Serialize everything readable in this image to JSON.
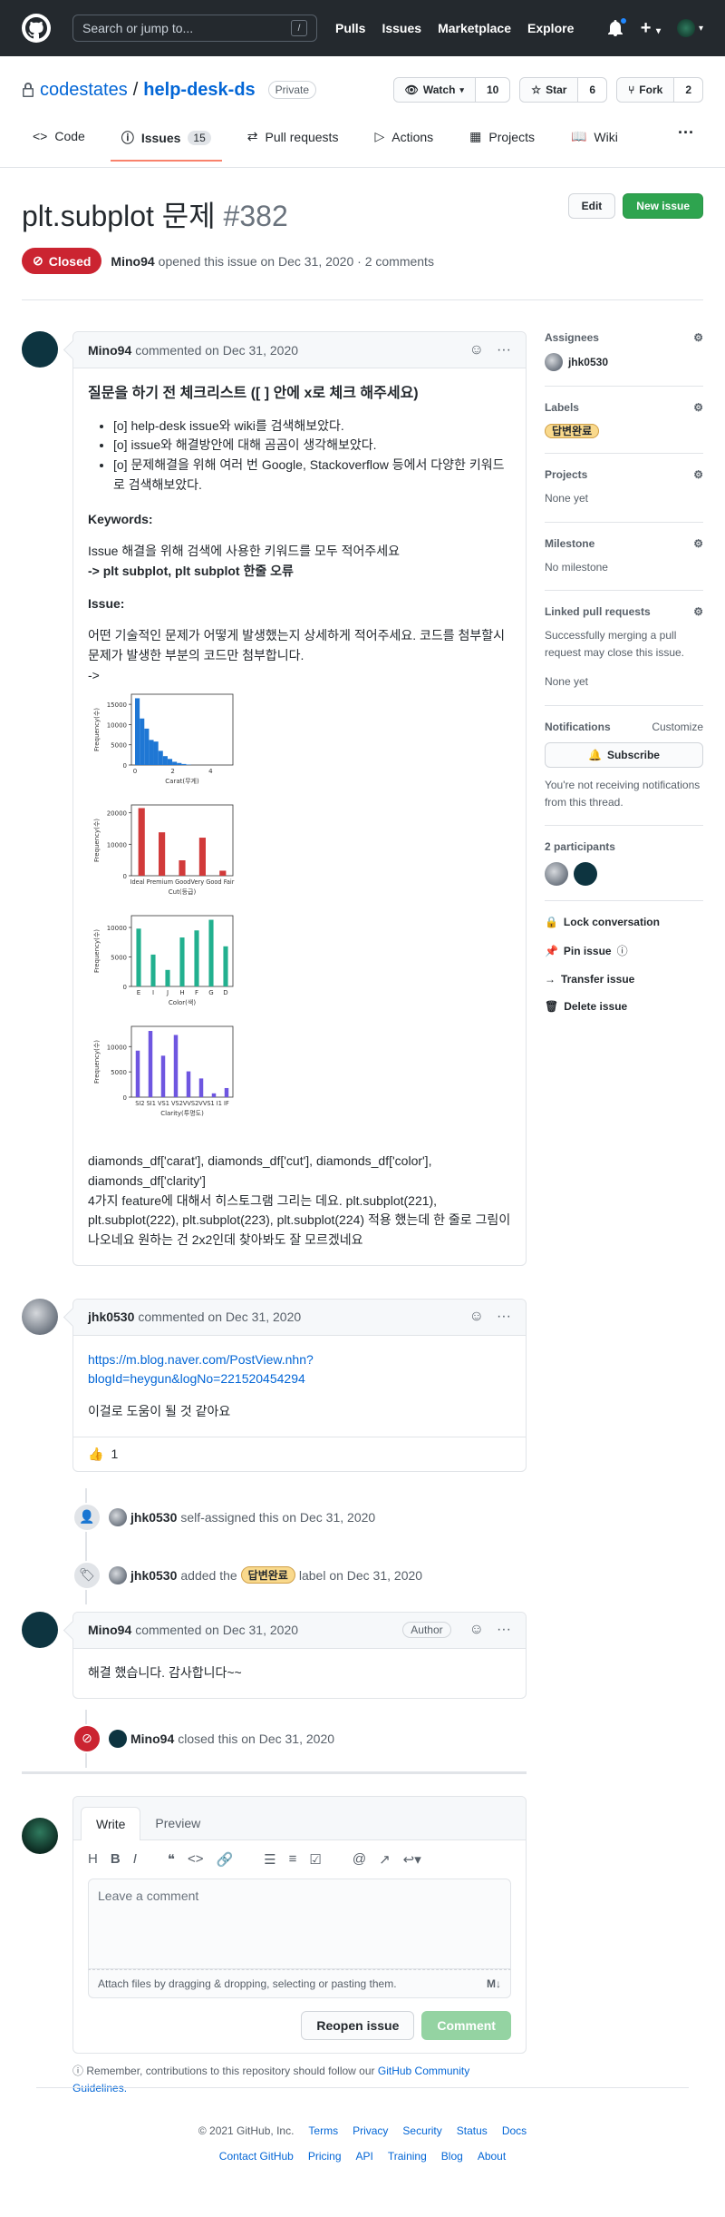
{
  "header": {
    "search_placeholder": "Search or jump to...",
    "slash_key": "/",
    "nav": [
      "Pulls",
      "Issues",
      "Marketplace",
      "Explore"
    ]
  },
  "repo": {
    "owner": "codestates",
    "separator": "/",
    "name": "help-desk-ds",
    "visibility": "Private",
    "watch_label": "Watch",
    "watch_count": "10",
    "star_label": "Star",
    "star_count": "6",
    "fork_label": "Fork",
    "fork_count": "2"
  },
  "tabs": {
    "code": "Code",
    "issues": "Issues",
    "issues_count": "15",
    "pulls": "Pull requests",
    "actions": "Actions",
    "projects": "Projects",
    "wiki": "Wiki",
    "more": "···"
  },
  "issue": {
    "title": "plt.subplot 문제",
    "number": "#382",
    "edit": "Edit",
    "new_issue": "New issue",
    "state": "Closed",
    "author": "Mino94",
    "meta": "opened this issue on Dec 31, 2020 · 2 comments"
  },
  "comment1": {
    "author": "Mino94",
    "meta": "commented on Dec 31, 2020",
    "heading": "질문을 하기 전 체크리스트 ([ ] 안에 x로 체크 해주세요)",
    "checklist": [
      "[o] help-desk issue와 wiki를 검색해보았다.",
      "[o] issue와 해결방안에 대해 곰곰이 생각해보았다.",
      "[o] 문제해결을 위해 여러 번 Google, Stackoverflow 등에서 다양한 키워드로 검색해보았다."
    ],
    "keywords_title": "Keywords:",
    "keywords_text": "Issue 해결을 위해 검색에 사용한 키워드를 모두 적어주세요",
    "keywords_value": "-> plt subplot, plt subplot 한줄 오류",
    "issue_title": "Issue:",
    "issue_text": "어떤 기술적인 문제가 어떻게 발생했는지 상세하게 적어주세요. 코드를 첨부할시 문제가 발생한 부분의 코드만 첨부합니다.",
    "arrow": "->",
    "footer_line1": "diamonds_df['carat'], diamonds_df['cut'], diamonds_df['color'], diamonds_df['clarity']",
    "footer_line2": "4가지 feature에 대해서 히스토그램 그리는 데요. plt.subplot(221), plt.subplot(222), plt.subplot(223), plt.subplot(224) 적용 했는데 한 줄로 그림이 나오네요 원하는 건 2x2인데 찾아봐도 잘 모르겠네요"
  },
  "chart_data": [
    {
      "type": "bar",
      "title": "",
      "xlabel": "Carat(무게)",
      "ylabel": "Frequency(수)",
      "x": [
        0.2,
        0.4,
        0.6,
        0.8,
        1.0,
        1.2,
        1.4,
        1.6,
        1.8,
        2.0,
        2.2,
        2.4
      ],
      "values": [
        16500,
        11500,
        9000,
        6200,
        5800,
        3500,
        2200,
        1500,
        800,
        500,
        250,
        100
      ],
      "xticks": [
        "0",
        "2",
        "4"
      ],
      "yticks": [
        "0",
        "5000",
        "10000",
        "15000"
      ],
      "ylim": [
        0,
        17500
      ],
      "color": "#1f77d4"
    },
    {
      "type": "bar",
      "title": "",
      "xlabel": "Cut(등급)",
      "ylabel": "Frequency(수)",
      "categories": [
        "Ideal",
        "Premium",
        "Good",
        "Very Good",
        "Fair"
      ],
      "xtick_text": "Ideal  Premium  GoodVery Good  Fair",
      "values": [
        21500,
        13800,
        4900,
        12100,
        1600
      ],
      "yticks": [
        "0",
        "10000",
        "20000"
      ],
      "ylim": [
        0,
        22500
      ],
      "color": "#d13a3a"
    },
    {
      "type": "bar",
      "title": "",
      "xlabel": "Color(색)",
      "ylabel": "Frequency(수)",
      "categories": [
        "E",
        "I",
        "J",
        "H",
        "F",
        "G",
        "D"
      ],
      "values": [
        9800,
        5400,
        2800,
        8300,
        9500,
        11300,
        6800
      ],
      "yticks": [
        "0",
        "5000",
        "10000"
      ],
      "ylim": [
        0,
        12000
      ],
      "color": "#22b08f"
    },
    {
      "type": "bar",
      "title": "",
      "xlabel": "Clarity(투명도)",
      "ylabel": "Frequency(수)",
      "categories": [
        "SI2",
        "SI1",
        "VS1",
        "VS2",
        "VVS2",
        "VVS1",
        "I1",
        "IF"
      ],
      "xtick_text": "SI2  SI1  VS1 VS2VVS2VVS1  I1   IF",
      "values": [
        9200,
        13100,
        8200,
        12300,
        5100,
        3700,
        750,
        1800
      ],
      "yticks": [
        "0",
        "5000",
        "10000"
      ],
      "ylim": [
        0,
        14000
      ],
      "color": "#6e56e0"
    }
  ],
  "comment2": {
    "author": "jhk0530",
    "meta": "commented on Dec 31, 2020",
    "link_line1": "https://m.blog.naver.com/PostView.nhn?",
    "link_line2": "blogId=heygun&logNo=221520454294",
    "text": "이걸로 도움이 될 것 같아요",
    "reaction_emoji": "👍",
    "reaction_count": "1"
  },
  "events": {
    "assign_user": "jhk0530",
    "assign_text": "self-assigned this on Dec 31, 2020",
    "label_user": "jhk0530",
    "label_prefix": "added the",
    "label_name": "답변완료",
    "label_suffix": "label on Dec 31, 2020",
    "close_user": "Mino94",
    "close_text": "closed this on Dec 31, 2020"
  },
  "comment3": {
    "author": "Mino94",
    "meta": "commented on Dec 31, 2020",
    "badge": "Author",
    "text": "해결 했습니다. 감사합니다~~"
  },
  "composer": {
    "write_tab": "Write",
    "preview_tab": "Preview",
    "placeholder": "Leave a comment",
    "attach_text": "Attach files by dragging & dropping, selecting or pasting them.",
    "reopen": "Reopen issue",
    "comment": "Comment",
    "guideline_prefix": "Remember, contributions to this repository should follow our",
    "guideline_link": "GitHub Community Guidelines."
  },
  "sidebar": {
    "assignees_title": "Assignees",
    "assignee": "jhk0530",
    "labels_title": "Labels",
    "label": "답변완료",
    "projects_title": "Projects",
    "projects_value": "None yet",
    "milestone_title": "Milestone",
    "milestone_value": "No milestone",
    "linked_title": "Linked pull requests",
    "linked_text": "Successfully merging a pull request may close this issue.",
    "linked_value": "None yet",
    "notifications_title": "Notifications",
    "customize": "Customize",
    "subscribe": "Subscribe",
    "notif_text": "You're not receiving notifications from this thread.",
    "participants_title": "2 participants",
    "lock": "Lock conversation",
    "pin": "Pin issue",
    "transfer": "Transfer issue",
    "delete": "Delete issue"
  },
  "footer": {
    "copyright": "© 2021 GitHub, Inc.",
    "row1": [
      "Terms",
      "Privacy",
      "Security",
      "Status",
      "Docs"
    ],
    "row2": [
      "Contact GitHub",
      "Pricing",
      "API",
      "Training",
      "Blog",
      "About"
    ]
  }
}
